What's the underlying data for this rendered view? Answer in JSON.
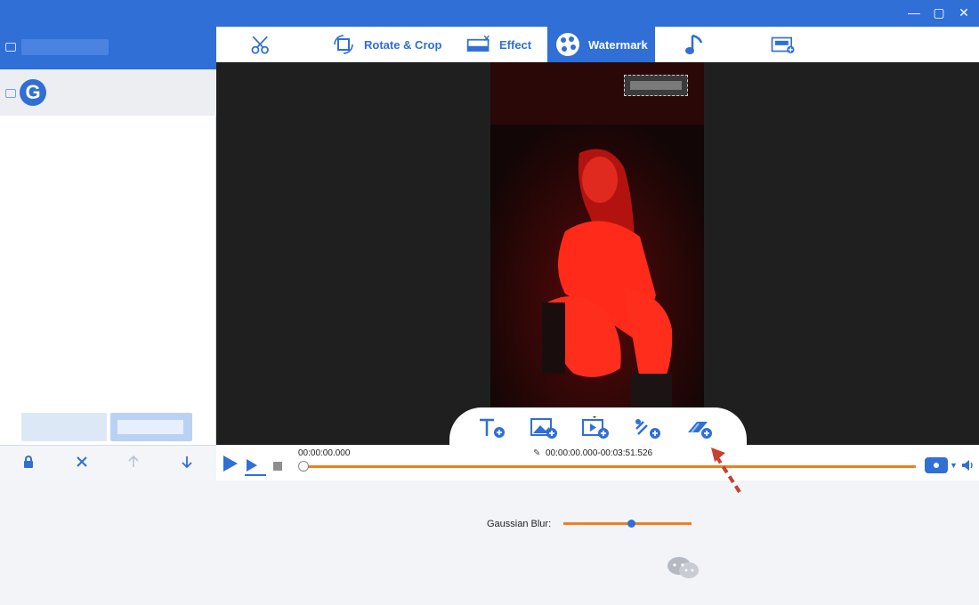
{
  "window": {
    "minimize": "—",
    "maximize": "▢",
    "close": "✕"
  },
  "tabs": [
    {
      "label": "",
      "icon": "scissors-icon"
    },
    {
      "label": "Rotate & Crop",
      "icon": "crop-rotate-icon"
    },
    {
      "label": "Effect",
      "icon": "effect-icon"
    },
    {
      "label": "Watermark",
      "icon": "watermark-icon",
      "active": true
    },
    {
      "label": "",
      "icon": "music-note-icon"
    },
    {
      "label": "",
      "icon": "subtitle-icon"
    }
  ],
  "left_panel": {
    "logo_letter": "G"
  },
  "timeline": {
    "current_time": "00:00:00.000",
    "range": "00:00:00.000-00:03:51.526"
  },
  "bottom": {
    "blur_label": "Gaussian Blur:",
    "blur_value": 0.53
  },
  "colors": {
    "accent": "#2f6fd6",
    "track": "#f07f1f"
  }
}
